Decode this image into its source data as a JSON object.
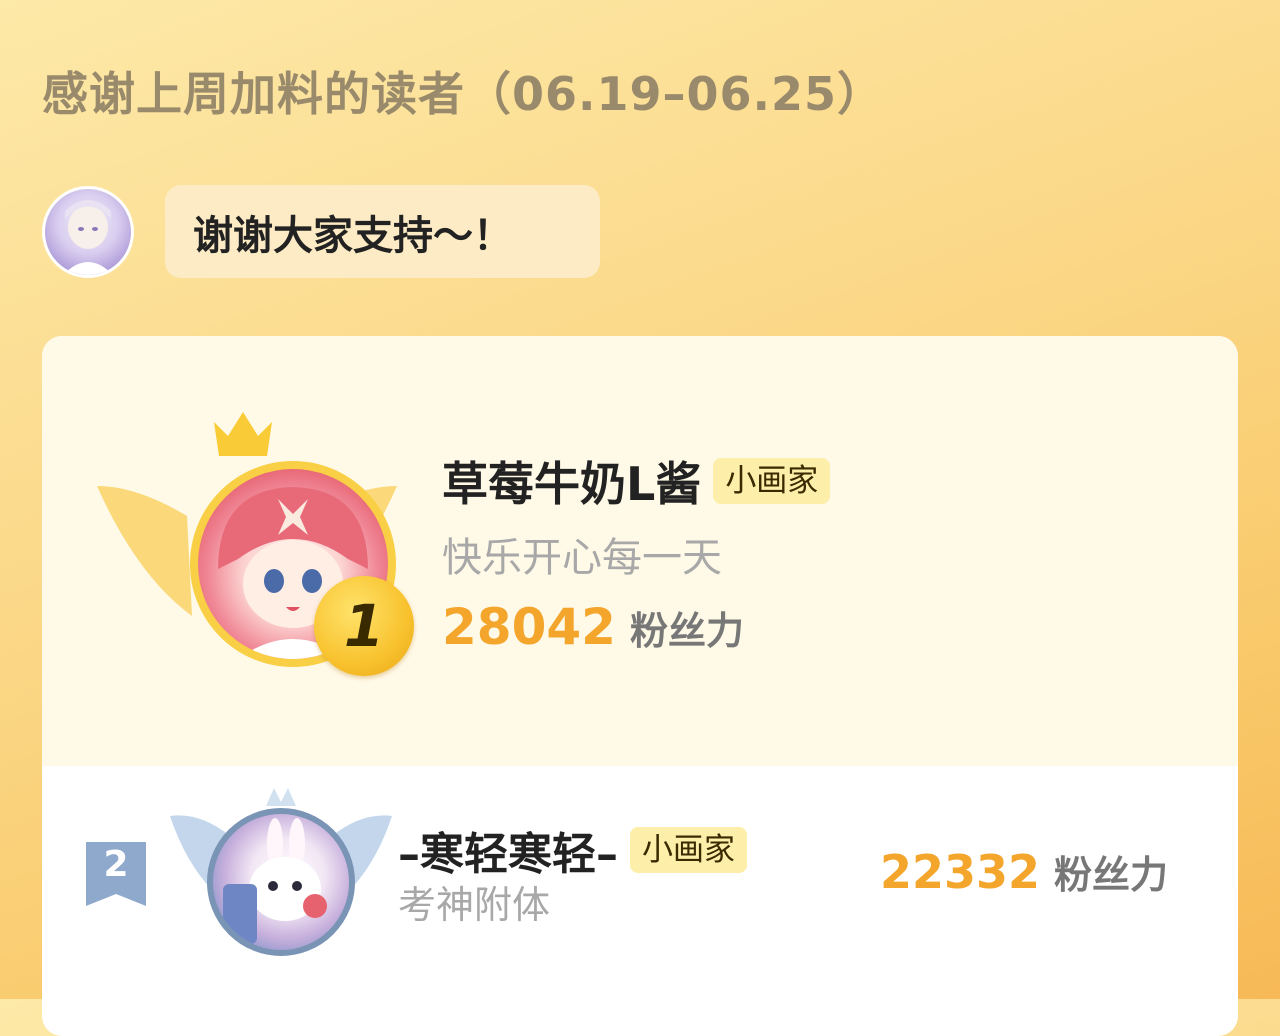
{
  "header": {
    "title": "感谢上周加料的读者（06.19–06.25）"
  },
  "host": {
    "message": "谢谢大家支持～！"
  },
  "ranking": [
    {
      "rank": "1",
      "name": "草莓牛奶L酱",
      "badge": "小画家",
      "motto": "快乐开心每一天",
      "fans": "28042",
      "fans_label": "粉丝力"
    },
    {
      "rank": "2",
      "name": "–寒轻寒轻–",
      "badge": "小画家",
      "motto": "考神附体",
      "fans": "22332",
      "fans_label": "粉丝力"
    }
  ],
  "colors": {
    "gold": "#f4a52c",
    "medal": "#f8c22e",
    "silver_badge": "#8fa9cc",
    "card_top": "#fff9e7"
  }
}
